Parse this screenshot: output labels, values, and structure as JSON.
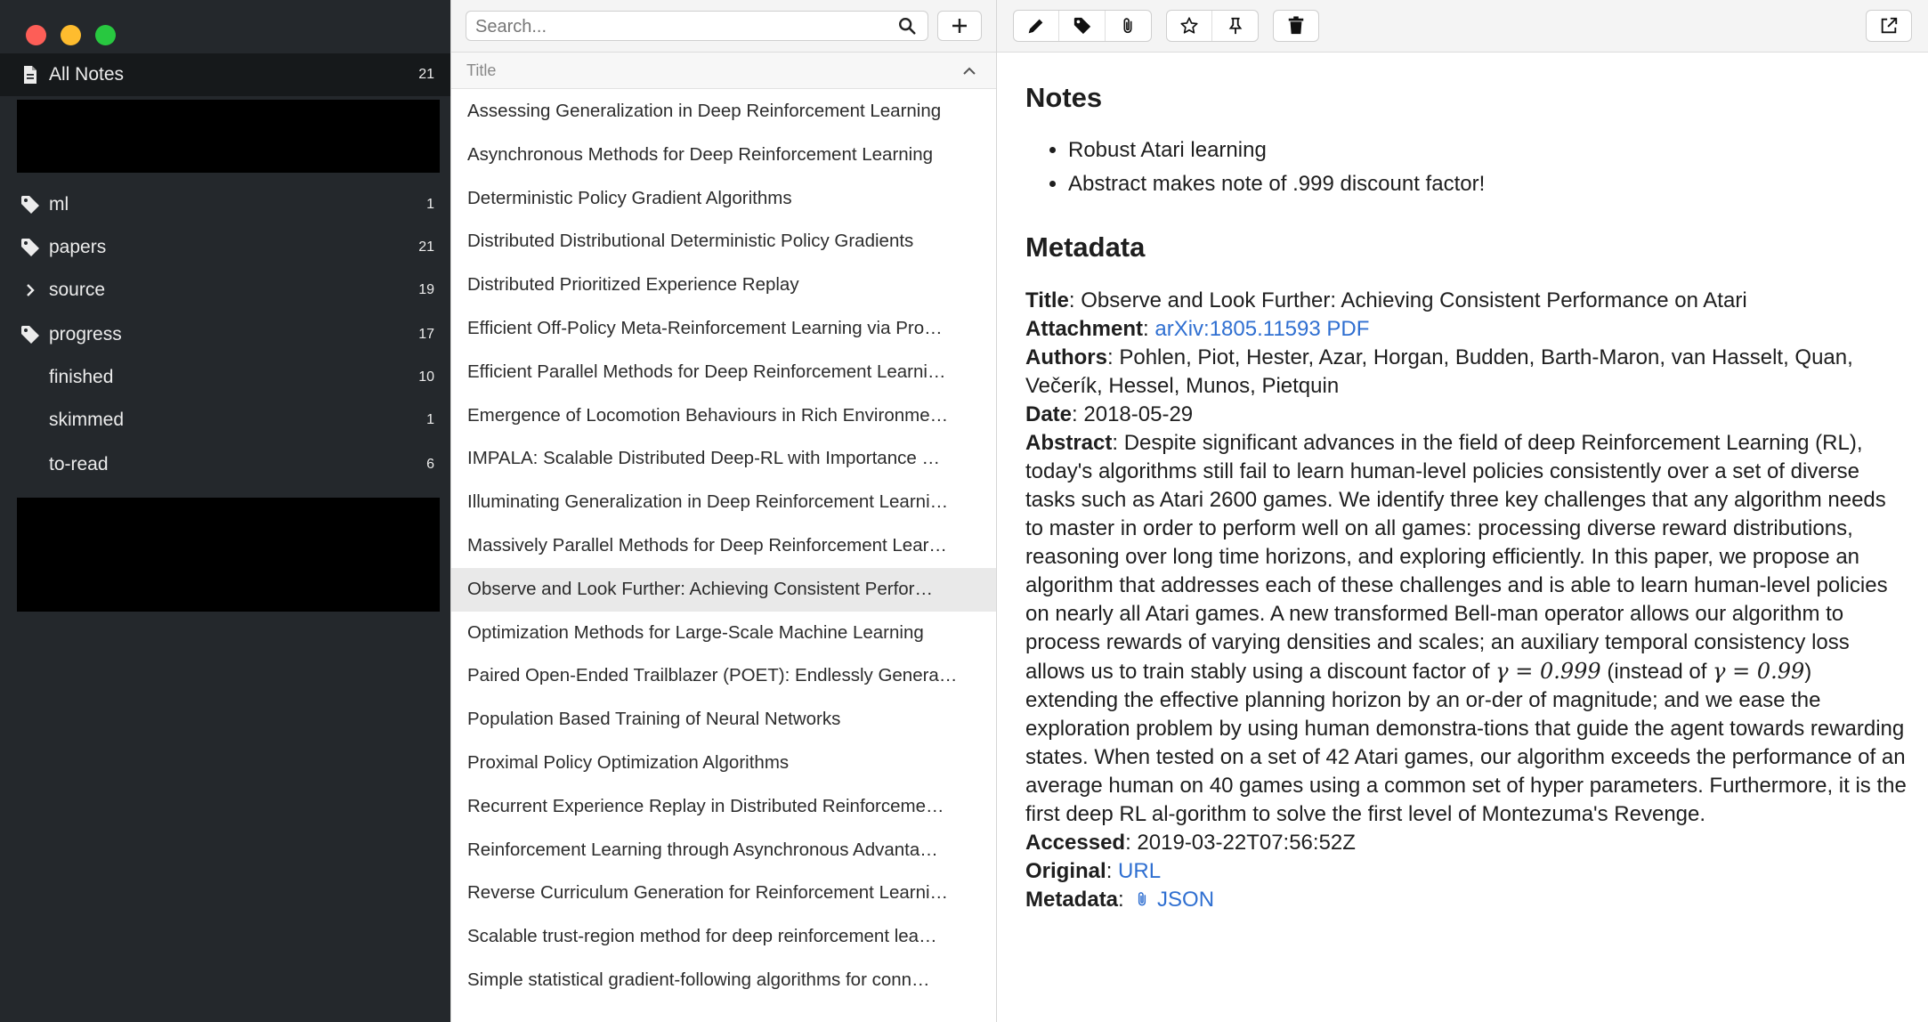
{
  "sidebar": {
    "all_notes": {
      "label": "All Notes",
      "count": "21"
    },
    "tags": [
      {
        "label": "ml",
        "count": "1",
        "icon": "tag-icon"
      },
      {
        "label": "papers",
        "count": "21",
        "icon": "tag-icon"
      },
      {
        "label": "source",
        "count": "19",
        "icon": "chevron-right-icon"
      },
      {
        "label": "progress",
        "count": "17",
        "icon": "tag-icon"
      },
      {
        "label": "finished",
        "count": "10"
      },
      {
        "label": "skimmed",
        "count": "1"
      },
      {
        "label": "to-read",
        "count": "6"
      }
    ]
  },
  "list": {
    "search_placeholder": "Search...",
    "column_header": "Title",
    "notes": [
      "Assessing Generalization in Deep Reinforcement Learning",
      "Asynchronous Methods for Deep Reinforcement Learning",
      "Deterministic Policy Gradient Algorithms",
      "Distributed Distributional Deterministic Policy Gradients",
      "Distributed Prioritized Experience Replay",
      "Efficient Off-Policy Meta-Reinforcement Learning via Pro…",
      "Efficient Parallel Methods for Deep Reinforcement Learni…",
      "Emergence of Locomotion Behaviours in Rich Environme…",
      "IMPALA: Scalable Distributed Deep-RL with Importance …",
      "Illuminating Generalization in Deep Reinforcement Learni…",
      "Massively Parallel Methods for Deep Reinforcement Lear…",
      "Observe and Look Further: Achieving Consistent Perfor…",
      "Optimization Methods for Large-Scale Machine Learning",
      "Paired Open-Ended Trailblazer (POET): Endlessly Genera…",
      "Population Based Training of Neural Networks",
      "Proximal Policy Optimization Algorithms",
      "Recurrent Experience Replay in Distributed Reinforceme…",
      "Reinforcement Learning through Asynchronous Advanta…",
      "Reverse Curriculum Generation for Reinforcement Learni…",
      "Scalable trust-region method for deep reinforcement lea…",
      "Simple statistical gradient-following algorithms for conn…"
    ],
    "selected_index": 11
  },
  "toolbar": {
    "icons": [
      "pencil-icon",
      "tag-icon",
      "paperclip-icon",
      "star-icon",
      "pin-icon",
      "trash-icon",
      "open-external-icon"
    ]
  },
  "note": {
    "notes_heading": "Notes",
    "bullets": [
      "Robust Atari learning",
      "Abstract makes note of .999 discount factor!"
    ],
    "metadata_heading": "Metadata",
    "title_label": "Title",
    "title_value": "Observe and Look Further: Achieving Consistent Performance on Atari",
    "attachment_label": "Attachment",
    "attachment_value": "arXiv:1805.11593 PDF",
    "authors_label": "Authors",
    "authors_value": "Pohlen, Piot, Hester, Azar, Horgan, Budden, Barth-Maron, van Hasselt, Quan, Večerík, Hessel, Munos, Pietquin",
    "date_label": "Date",
    "date_value": "2018-05-29",
    "abstract_label": "Abstract",
    "abstract_p1": "Despite significant advances in the field of deep Reinforcement Learning (RL), today's algorithms still fail to learn human-level policies consistently over a set of diverse tasks such as Atari 2600 games. We identify three key challenges that any algorithm needs to master in order to perform well on all games: processing diverse reward distributions, reasoning over long time horizons, and exploring efficiently. In this paper, we propose an algorithm that addresses each of these challenges and is able to learn human-level policies on nearly all Atari games. A new transformed Bell-man operator allows our algorithm to process rewards of varying densities and scales; an auxiliary temporal consistency loss allows us to train stably using a discount factor of",
    "math_1": "γ = 0.999",
    "abstract_p2": "(instead of",
    "math_2": "γ = 0.99",
    "abstract_p3": ") extending the effective planning horizon by an or-der of magnitude; and we ease the exploration problem by using human demonstra-tions that guide the agent towards rewarding states. When tested on a set of 42 Atari games, our algorithm exceeds the performance of an average human on 40 games using a common set of hyper parameters. Furthermore, it is the first deep RL al-gorithm to solve the first level of Montezuma's Revenge.",
    "accessed_label": "Accessed",
    "accessed_value": "2019-03-22T07:56:52Z",
    "original_label": "Original",
    "original_value": "URL",
    "metadata_label": "Metadata",
    "metadata_value": "JSON"
  },
  "colors": {
    "sidebar_bg": "#24282c",
    "link": "#2f6fd1",
    "selected_row": "#e9e9e9"
  }
}
